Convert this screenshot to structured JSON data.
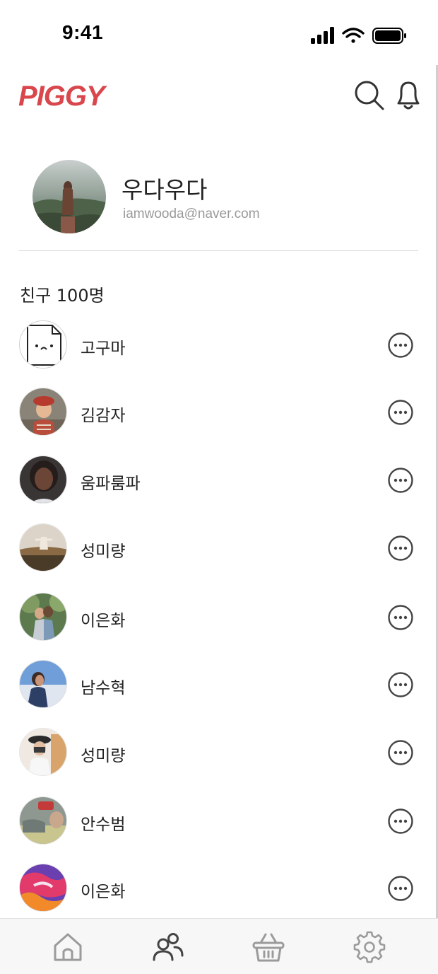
{
  "status_bar": {
    "time": "9:41",
    "icons": [
      "cellular-signal-icon",
      "wifi-icon",
      "battery-icon"
    ]
  },
  "header": {
    "logo": "PIGGY",
    "icons": [
      "search-icon",
      "bell-icon"
    ],
    "logo_color": "#d9464b"
  },
  "profile": {
    "name": "우다우다",
    "email": "iamwooda@naver.com"
  },
  "friends": {
    "title": "친구 100명",
    "items": [
      {
        "name": "고구마",
        "avatar": "placeholder-face"
      },
      {
        "name": "김감자",
        "avatar": "photo"
      },
      {
        "name": "움파룸파",
        "avatar": "photo"
      },
      {
        "name": "성미량",
        "avatar": "photo"
      },
      {
        "name": "이은화",
        "avatar": "photo"
      },
      {
        "name": "남수혁",
        "avatar": "photo"
      },
      {
        "name": "성미량",
        "avatar": "photo"
      },
      {
        "name": "안수범",
        "avatar": "photo"
      },
      {
        "name": "이은화",
        "avatar": "photo"
      }
    ]
  },
  "bottom_nav": {
    "items": [
      {
        "icon": "home-icon",
        "active": false
      },
      {
        "icon": "friends-icon",
        "active": true
      },
      {
        "icon": "basket-icon",
        "active": false
      },
      {
        "icon": "settings-icon",
        "active": false
      }
    ],
    "active_color": "#444444",
    "inactive_color": "#9b9b9b"
  }
}
